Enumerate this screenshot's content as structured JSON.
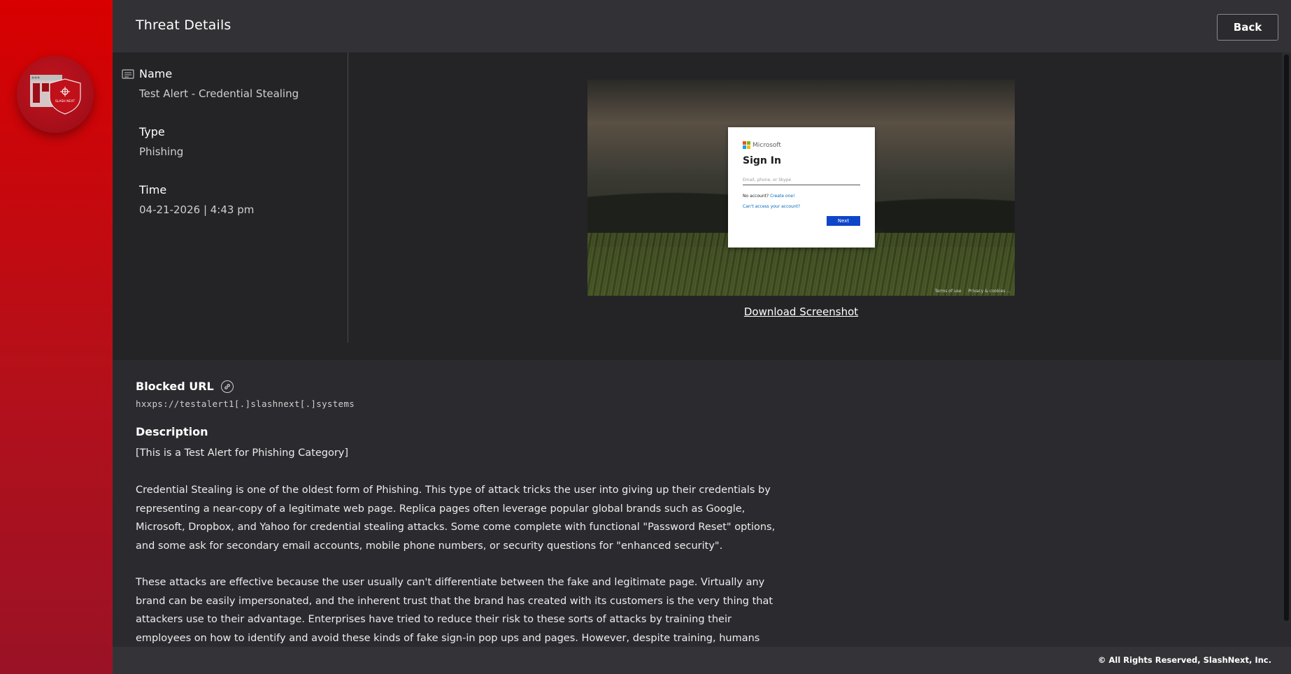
{
  "header": {
    "title": "Threat Details",
    "back_label": "Back"
  },
  "brand": {
    "logo_text": "SLASH NEXT",
    "accent_color": "#d80000"
  },
  "threat": {
    "name_label": "Name",
    "name_value": "Test Alert - Credential Stealing",
    "type_label": "Type",
    "type_value": "Phishing",
    "time_label": "Time",
    "time_value": "04-21-2026 | 4:43 pm"
  },
  "screenshot": {
    "brand": "Microsoft",
    "title": "Sign In",
    "input_placeholder": "Email, phone, or Skype",
    "no_account": "No account?",
    "create_one": "Create one!",
    "cant_access": "Can't access your account?",
    "next_button": "Next",
    "footer_terms": "Terms of use",
    "footer_privacy": "Privacy & cookies ...",
    "download_label": "Download Screenshot"
  },
  "blocked_url": {
    "title": "Blocked URL",
    "value": "hxxps://testalert1[.]slashnext[.]systems"
  },
  "description": {
    "title": "Description",
    "line1": "[This is a Test Alert for Phishing Category]",
    "para1": "Credential Stealing is one of the oldest form of Phishing. This type of attack tricks the user into giving up their credentials by representing a near-copy of a legitimate web page. Replica pages often leverage popular global brands such as Google, Microsoft, Dropbox, and Yahoo for credential stealing attacks. Some come complete with functional \"Password Reset\" options, and some ask for secondary email accounts, mobile phone numbers, or security questions for \"enhanced security\".",
    "para2": "These attacks are effective because the user usually can't differentiate between the fake and legitimate page. Virtually any brand can be easily impersonated, and the inherent trust that the brand has created with its customers is the very thing that attackers use to their advantage. Enterprises have tried to reduce their risk to these sorts of attacks by training their employees on how to identify and avoid these kinds of fake sign-in pop ups and pages. However, despite training, humans"
  },
  "footer": {
    "copyright": "© All Rights Reserved, SlashNext, Inc."
  }
}
